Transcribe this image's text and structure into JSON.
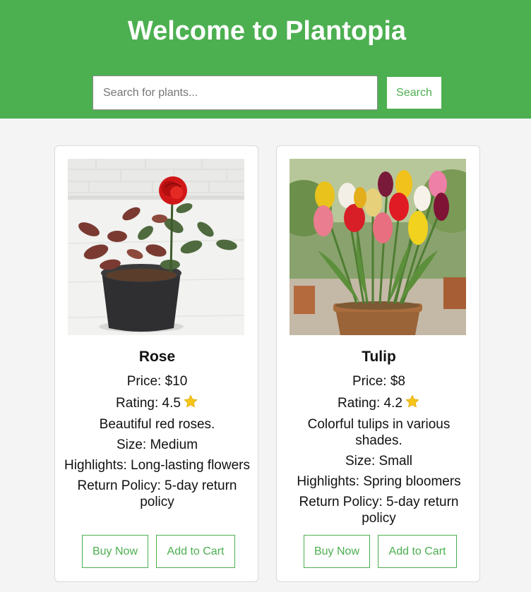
{
  "header": {
    "title": "Welcome to Plantopia",
    "search_placeholder": "Search for plants...",
    "search_button": "Search",
    "background_color": "#4caf50"
  },
  "products": [
    {
      "name": "Rose",
      "price": "Price: $10",
      "rating": "Rating: 4.5",
      "description": "Beautiful red roses.",
      "size": "Size: Medium",
      "highlights": "Highlights: Long-lasting flowers",
      "return_policy": "Return Policy: 5-day return policy",
      "buy_label": "Buy Now",
      "cart_label": "Add to Cart",
      "image_icon": "rose-plant-photo"
    },
    {
      "name": "Tulip",
      "price": "Price: $8",
      "rating": "Rating: 4.2",
      "description": "Colorful tulips in various shades.",
      "size": "Size: Small",
      "highlights": "Highlights: Spring bloomers",
      "return_policy": "Return Policy: 5-day return policy",
      "buy_label": "Buy Now",
      "cart_label": "Add to Cart",
      "image_icon": "tulip-plant-photo"
    }
  ],
  "colors": {
    "accent": "#4caf50",
    "star": "#f5c518",
    "page_background": "#f4f4f4"
  }
}
